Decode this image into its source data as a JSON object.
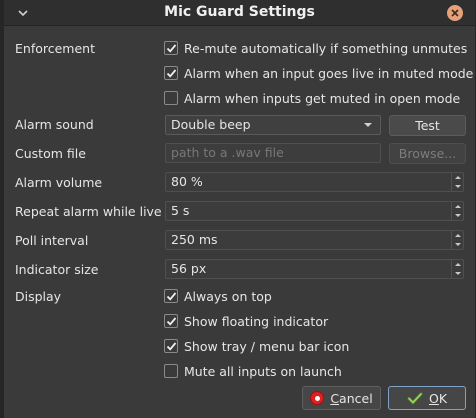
{
  "window": {
    "title": "Mic Guard Settings"
  },
  "labels": {
    "enforcement": "Enforcement",
    "alarm_sound": "Alarm sound",
    "custom_file": "Custom file",
    "alarm_volume": "Alarm volume",
    "repeat_alarm": "Repeat alarm while live",
    "poll_interval": "Poll interval",
    "indicator_size": "Indicator size",
    "display": "Display"
  },
  "enforcement_options": [
    {
      "label": "Re-mute automatically if something unmutes",
      "checked": true
    },
    {
      "label": "Alarm when an input goes live in muted mode",
      "checked": true
    },
    {
      "label": "Alarm when inputs get muted in open mode",
      "checked": false
    }
  ],
  "alarm_sound": {
    "selected": "Double beep",
    "test_label": "Test"
  },
  "custom_file": {
    "placeholder": "path to a .wav file",
    "browse_label": "Browse..."
  },
  "alarm_volume": {
    "value": "80 %"
  },
  "repeat_alarm": {
    "value": "5 s"
  },
  "poll_interval": {
    "value": "250 ms"
  },
  "indicator_size": {
    "value": "56 px"
  },
  "display_options": [
    {
      "label": "Always on top",
      "checked": true
    },
    {
      "label": "Show floating indicator",
      "checked": true
    },
    {
      "label": "Show tray / menu bar icon",
      "checked": true
    },
    {
      "label": "Mute all inputs on launch",
      "checked": false
    }
  ],
  "footer": {
    "cancel_prefix": "",
    "cancel_underlined": "C",
    "cancel_rest": "ancel",
    "ok_underlined": "O",
    "ok_rest": "K"
  },
  "colors": {
    "accent": "#7fa2c8",
    "window_bg": "#3a3a3a",
    "close": "#e6a07a",
    "cancel_red": "#e02020",
    "ok_green": "#8bc34a"
  },
  "icons": {
    "menu": "chevron-down-icon",
    "close": "close-icon",
    "cancel": "cancel-icon",
    "ok": "ok-checkmark-icon"
  }
}
